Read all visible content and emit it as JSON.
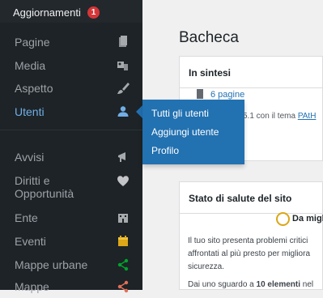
{
  "sidebar": {
    "updates": {
      "label": "Aggiornamenti",
      "badge": "1"
    },
    "items": [
      {
        "label": "Pagine",
        "icon": "pages-icon"
      },
      {
        "label": "Media",
        "icon": "media-icon"
      },
      {
        "label": "Aspetto",
        "icon": "appearance-brush-icon"
      },
      {
        "label": "Utenti",
        "icon": "users-icon",
        "active": true
      },
      {
        "label": "Avvisi",
        "icon": "megaphone-icon"
      },
      {
        "label": "Diritti e Opportunità",
        "icon": "heart-icon"
      },
      {
        "label": "Ente",
        "icon": "building-icon"
      },
      {
        "label": "Eventi",
        "icon": "calendar-icon"
      },
      {
        "label": "Mappe urbane",
        "icon": "share-nodes-icon"
      },
      {
        "label": "Mappe",
        "icon": "share-nodes-icon"
      }
    ]
  },
  "flyout": {
    "items": [
      "Tutti gli utenti",
      "Aggiungi utente",
      "Profilo"
    ]
  },
  "main": {
    "title": "Bacheca",
    "glance": {
      "title": "In sintesi",
      "pages": "6 pagine",
      "theme_text": "5.1 con il tema ",
      "theme_link": "PAtH"
    },
    "health": {
      "title": "Stato di salute del sito",
      "status": "Da migl",
      "line1": "Il tuo sito presenta problemi critici",
      "line2": "affrontati al più presto per migliora",
      "line3": "sicurezza.",
      "line4_pre": "Dai uno sguardo a ",
      "line4_bold": "10 elementi",
      "line4_post": " nel"
    }
  },
  "colors": {
    "sidebar_bg": "#1d2327",
    "accent": "#2271b1",
    "active_text": "#72aee6",
    "badge": "#d63638",
    "green_icon": "#00a32a",
    "warning": "#dba617"
  }
}
